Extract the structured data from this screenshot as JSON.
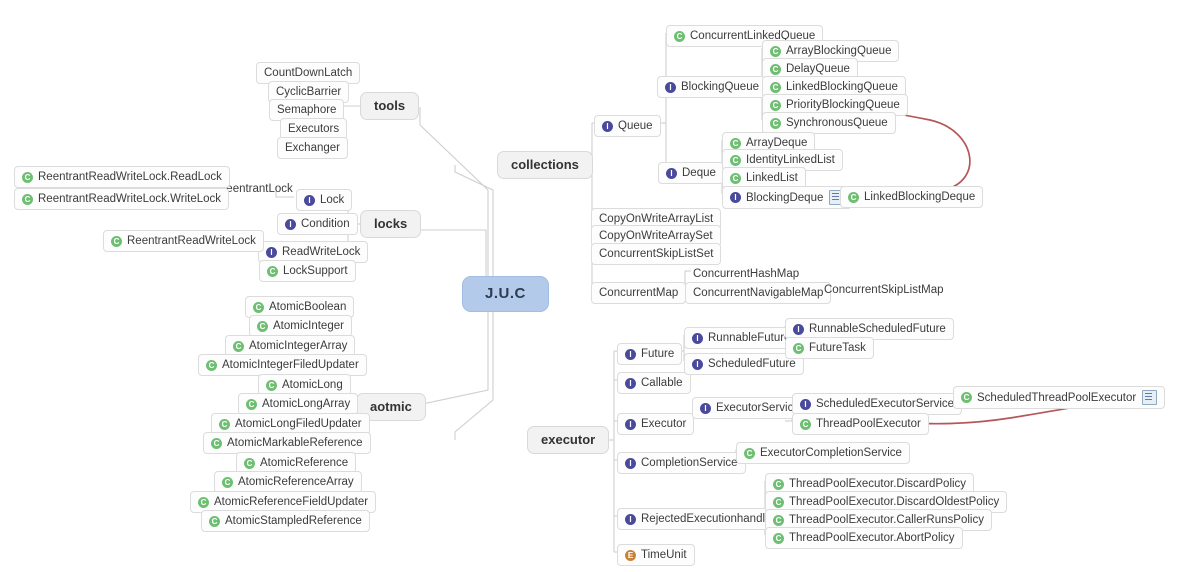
{
  "root": {
    "label": "J.U.C"
  },
  "branches": [
    {
      "id": "tools",
      "label": "tools"
    },
    {
      "id": "locks",
      "label": "locks"
    },
    {
      "id": "aotmic",
      "label": "aotmic"
    },
    {
      "id": "collections",
      "label": "collections"
    },
    {
      "id": "executor",
      "label": "executor"
    }
  ],
  "colors": {
    "root_fill": "#b3caea",
    "branch_fill": "#f2f2f2",
    "node_fill": "#fdfdfd",
    "node_border": "#dcdcdc",
    "connector": "#c9c9c9",
    "arrow": "#b5565a",
    "interface_icon": "#4a4a9c",
    "class_icon": "#6fbf73",
    "enum_icon": "#c8833a"
  },
  "icons": {
    "interface": "I",
    "class": "C",
    "enum": "E",
    "note": "note-icon"
  },
  "tools": {
    "items": [
      {
        "label": "CountDownLatch"
      },
      {
        "label": "CyclicBarrier"
      },
      {
        "label": "Semaphore"
      },
      {
        "label": "Executors"
      },
      {
        "label": "Exchanger"
      }
    ]
  },
  "locks": {
    "items": [
      {
        "label": "Lock",
        "icon": "interface"
      },
      {
        "label": "Condition",
        "icon": "interface"
      },
      {
        "label": "ReadWriteLock",
        "icon": "interface"
      },
      {
        "label": "LockSupport",
        "icon": "class"
      }
    ],
    "lock_children": [
      {
        "label": "ReentrantLock",
        "icon": "none",
        "boxed": false
      }
    ],
    "reentrantlock_children": [
      {
        "label": "ReentrantReadWriteLock.ReadLock",
        "icon": "class"
      },
      {
        "label": "ReentrantReadWriteLock.WriteLock",
        "icon": "class"
      }
    ],
    "readwritelock_children": [
      {
        "label": "ReentrantReadWriteLock",
        "icon": "class"
      }
    ]
  },
  "aotmic": {
    "items": [
      {
        "label": "AtomicBoolean",
        "icon": "class"
      },
      {
        "label": "AtomicInteger",
        "icon": "class"
      },
      {
        "label": "AtomicIntegerArray",
        "icon": "class"
      },
      {
        "label": "AtomicIntegerFiledUpdater",
        "icon": "class"
      },
      {
        "label": "AtomicLong",
        "icon": "class"
      },
      {
        "label": "AtomicLongArray",
        "icon": "class"
      },
      {
        "label": "AtomicLongFiledUpdater",
        "icon": "class"
      },
      {
        "label": "AtomicMarkableReference",
        "icon": "class"
      },
      {
        "label": "AtomicReference",
        "icon": "class"
      },
      {
        "label": "AtomicReferenceArray",
        "icon": "class"
      },
      {
        "label": "AtomicReferenceFieldUpdater",
        "icon": "class"
      },
      {
        "label": "AtomicStampledReference",
        "icon": "class"
      }
    ]
  },
  "collections": {
    "queue": {
      "label": "Queue",
      "icon": "interface"
    },
    "queue_children": [
      {
        "label": "ConcurrentLinkedQueue",
        "icon": "class"
      },
      {
        "label": "BlockingQueue",
        "icon": "interface"
      }
    ],
    "blockingqueue_children": [
      {
        "label": "ArrayBlockingQueue",
        "icon": "class"
      },
      {
        "label": "DelayQueue",
        "icon": "class"
      },
      {
        "label": "LinkedBlockingQueue",
        "icon": "class"
      },
      {
        "label": "PriorityBlockingQueue",
        "icon": "class"
      },
      {
        "label": "SynchronousQueue",
        "icon": "class"
      }
    ],
    "deque": {
      "label": "Deque",
      "icon": "interface"
    },
    "deque_children": [
      {
        "label": "ArrayDeque",
        "icon": "class"
      },
      {
        "label": "IdentityLinkedList",
        "icon": "class"
      },
      {
        "label": "LinkedList",
        "icon": "class"
      },
      {
        "label": "BlockingDeque",
        "icon": "interface",
        "note": true
      }
    ],
    "blockingdeque_children": [
      {
        "label": "LinkedBlockingDeque",
        "icon": "class"
      }
    ],
    "others": [
      {
        "label": "CopyOnWriteArrayList",
        "icon": "none"
      },
      {
        "label": "CopyOnWriteArraySet",
        "icon": "none"
      },
      {
        "label": "ConcurrentSkipListSet",
        "icon": "none"
      }
    ],
    "concurrent_map": {
      "label": "ConcurrentMap",
      "icon": "none"
    },
    "concurrent_map_children": [
      {
        "label": "ConcurrentHashMap",
        "icon": "none",
        "boxed": false
      },
      {
        "label": "ConcurrentNavigableMap",
        "icon": "none"
      }
    ],
    "navigable_map_children": [
      {
        "label": "ConcurrentSkipListMap",
        "icon": "none",
        "boxed": false
      }
    ]
  },
  "executor": {
    "items": [
      {
        "label": "Future",
        "icon": "interface"
      },
      {
        "label": "Callable",
        "icon": "interface"
      },
      {
        "label": "Executor",
        "icon": "interface"
      },
      {
        "label": "CompletionService",
        "icon": "interface"
      },
      {
        "label": "RejectedExecutionhandler",
        "icon": "interface"
      },
      {
        "label": "TimeUnit",
        "icon": "enum"
      }
    ],
    "future_children": [
      {
        "label": "RunnableFuture",
        "icon": "interface"
      },
      {
        "label": "ScheduledFuture",
        "icon": "interface"
      }
    ],
    "runnablefuture_children": [
      {
        "label": "RunnableScheduledFuture",
        "icon": "interface"
      },
      {
        "label": "FutureTask",
        "icon": "class"
      }
    ],
    "executor_children": [
      {
        "label": "ExecutorService",
        "icon": "interface"
      }
    ],
    "executorservice_children": [
      {
        "label": "ScheduledExecutorService",
        "icon": "interface"
      },
      {
        "label": "ThreadPoolExecutor",
        "icon": "class"
      }
    ],
    "scheduledexecutorservice_children": [
      {
        "label": "ScheduledThreadPoolExecutor",
        "icon": "class",
        "note": true
      }
    ],
    "completionservice_children": [
      {
        "label": "ExecutorCompletionService",
        "icon": "class"
      }
    ],
    "rejected_children": [
      {
        "label": "ThreadPoolExecutor.DiscardPolicy",
        "icon": "class"
      },
      {
        "label": "ThreadPoolExecutor.DiscardOldestPolicy",
        "icon": "class"
      },
      {
        "label": "ThreadPoolExecutor.CallerRunsPolicy",
        "icon": "class"
      },
      {
        "label": "ThreadPoolExecutor.AbortPolicy",
        "icon": "class"
      }
    ]
  },
  "annotations": [
    {
      "id": "arrow-linkedblockingdeque-to-blockingqueue",
      "from": "LinkedBlockingDeque",
      "to": "BlockingQueue"
    },
    {
      "id": "arrow-scheduledthreadpoolexecutor-to-threadpoolexecutor",
      "from": "ScheduledThreadPoolExecutor",
      "to": "ThreadPoolExecutor"
    }
  ]
}
